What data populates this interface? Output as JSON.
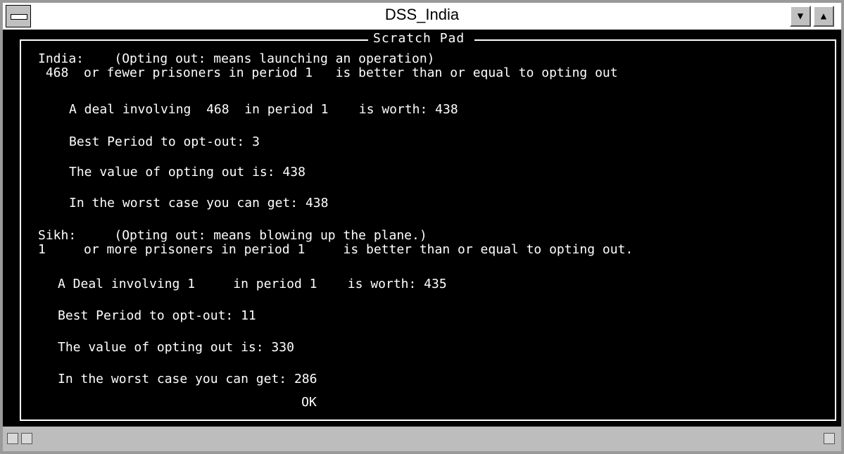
{
  "window": {
    "title": "DSS_India"
  },
  "scratch_pad": {
    "title": "Scratch Pad",
    "india": {
      "heading": "India:    (Opting out: means launching an operation)",
      "threshold": " 468  or fewer prisoners in period 1   is better than or equal to opting out",
      "deal": "A deal involving  468  in period 1    is worth: 438",
      "best_period": "Best Period to opt-out: 3",
      "opt_value": "The value of opting out is: 438",
      "worst_case": "In the worst case you can get: 438"
    },
    "sikh": {
      "heading": "Sikh:     (Opting out: means blowing up the plane.)",
      "threshold": "1     or more prisoners in period 1     is better than or equal to opting out.",
      "deal": "A Deal involving 1     in period 1    is worth: 435",
      "best_period": "Best Period to opt-out: 11",
      "opt_value": "The value of opting out is: 330",
      "worst_case": "In the worst case you can get: 286"
    },
    "ok_label": "OK"
  }
}
